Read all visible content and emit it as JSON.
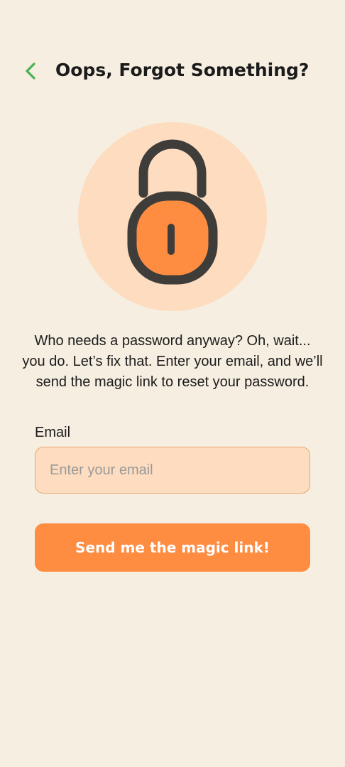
{
  "header": {
    "back_icon": "chevron-left-icon",
    "title": "Oops, Forgot Something?"
  },
  "illustration": {
    "icon": "padlock-icon"
  },
  "description": "Who needs a password anyway? Oh, wait... you do. Let’s fix that. Enter your email, and we’ll send the magic link to reset your password.",
  "form": {
    "email_label": "Email",
    "email_value": "",
    "email_placeholder": "Enter your email",
    "submit_label": "Send me the magic link!"
  },
  "colors": {
    "background": "#f6eee1",
    "accent": "#fe8c41",
    "accent_light": "#fddcbf",
    "back_chevron": "#4caf50",
    "lock_outline": "#3f3d3a"
  }
}
